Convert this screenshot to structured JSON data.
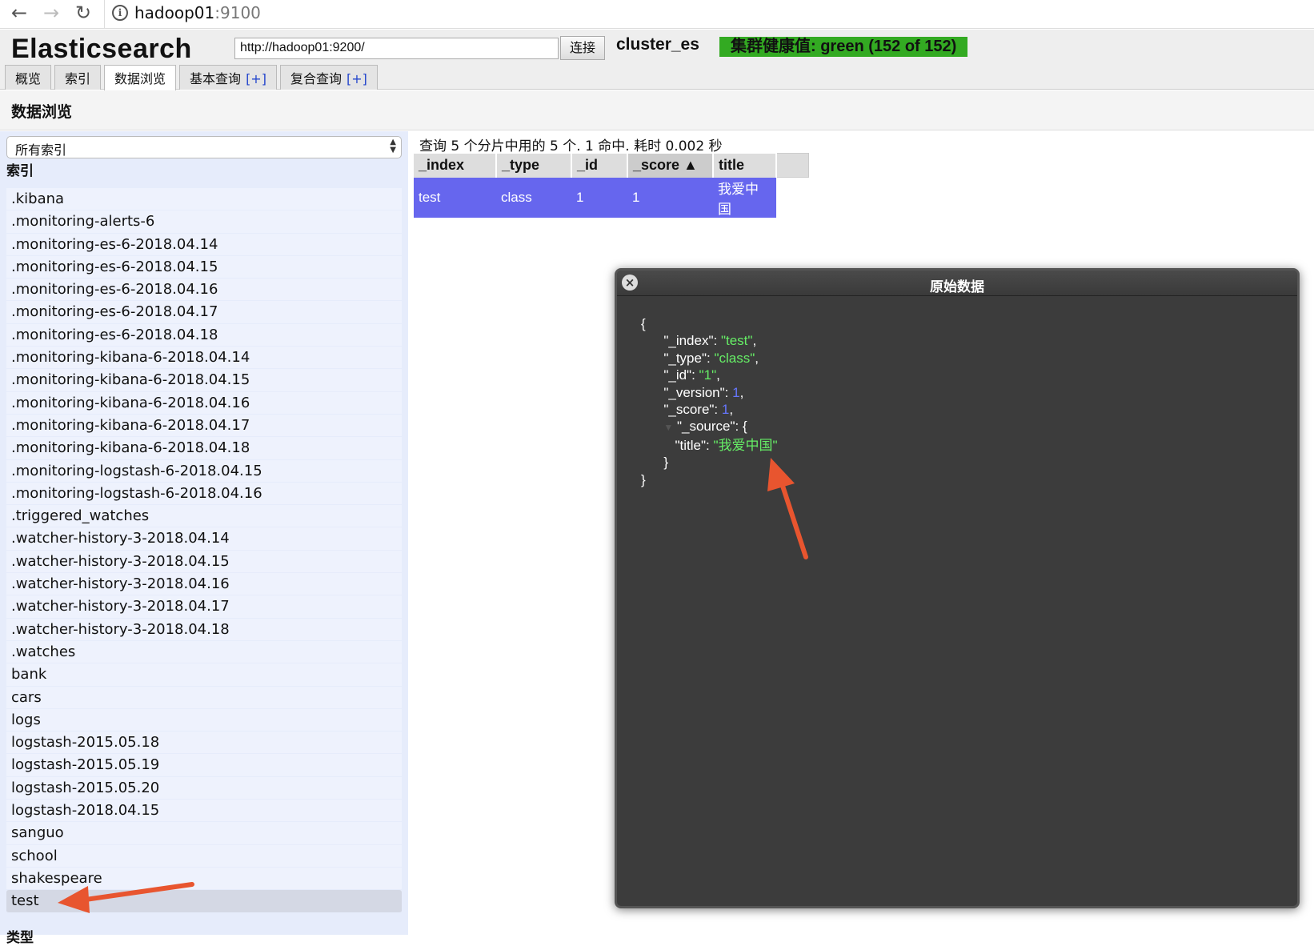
{
  "browser": {
    "url_host": "hadoop01",
    "url_port": ":9100"
  },
  "header": {
    "app_title": "Elasticsearch",
    "connect_url": "http://hadoop01:9200/",
    "connect_label": "连接",
    "cluster_name": "cluster_es",
    "health": "集群健康值: green (152 of 152)",
    "health_color": "#33aa22"
  },
  "tabs": [
    {
      "label": "概览",
      "plus": ""
    },
    {
      "label": "索引",
      "plus": ""
    },
    {
      "label": "数据浏览",
      "plus": ""
    },
    {
      "label": "基本查询",
      "plus": "[+]"
    },
    {
      "label": "复合查询",
      "plus": "[+]"
    }
  ],
  "section_title": "数据浏览",
  "sidebar": {
    "index_select": "所有索引",
    "indices_heading": "索引",
    "types_heading": "类型",
    "indices": [
      ".kibana",
      ".monitoring-alerts-6",
      ".monitoring-es-6-2018.04.14",
      ".monitoring-es-6-2018.04.15",
      ".monitoring-es-6-2018.04.16",
      ".monitoring-es-6-2018.04.17",
      ".monitoring-es-6-2018.04.18",
      ".monitoring-kibana-6-2018.04.14",
      ".monitoring-kibana-6-2018.04.15",
      ".monitoring-kibana-6-2018.04.16",
      ".monitoring-kibana-6-2018.04.17",
      ".monitoring-kibana-6-2018.04.18",
      ".monitoring-logstash-6-2018.04.15",
      ".monitoring-logstash-6-2018.04.16",
      ".triggered_watches",
      ".watcher-history-3-2018.04.14",
      ".watcher-history-3-2018.04.15",
      ".watcher-history-3-2018.04.16",
      ".watcher-history-3-2018.04.17",
      ".watcher-history-3-2018.04.18",
      ".watches",
      "bank",
      "cars",
      "logs",
      "logstash-2015.05.18",
      "logstash-2015.05.19",
      "logstash-2015.05.20",
      "logstash-2018.04.15",
      "sanguo",
      "school",
      "shakespeare",
      "test"
    ],
    "selected_index": "test"
  },
  "results": {
    "query_info": "查询 5 个分片中用的 5 个. 1 命中. 耗时 0.002 秒",
    "columns": [
      "_index",
      "_type",
      "_id",
      "_score ▲",
      "title"
    ],
    "rows": [
      [
        "test",
        "class",
        "1",
        "1",
        "我爱中国"
      ]
    ]
  },
  "dialog": {
    "title": "原始数据",
    "close_icon": "close-icon",
    "json": {
      "_index": "test",
      "_type": "class",
      "_id": "1",
      "_version": "1",
      "_score": "1",
      "source_key": "\"_source\"",
      "source_title": "我爱中国"
    }
  },
  "annotations": {
    "arrow_color": "#e8552f"
  }
}
